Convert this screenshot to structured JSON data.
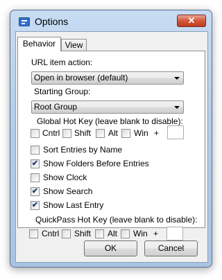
{
  "window": {
    "title": "Options",
    "close_label": "✕"
  },
  "tabs": [
    {
      "label": "Behavior",
      "active": true
    },
    {
      "label": "View",
      "active": false
    }
  ],
  "url_action": {
    "label": "URL item action:",
    "value": "Open in browser (default)"
  },
  "starting_group": {
    "label": "Starting Group:",
    "value": "Root Group"
  },
  "global_hotkey": {
    "label": "Global Hot Key (leave blank to disable):",
    "modifiers": [
      "Cntrl",
      "Shift",
      "Alt",
      "Win"
    ],
    "plus": "+"
  },
  "options": [
    {
      "label": "Sort Entries by Name",
      "checked": false
    },
    {
      "label": "Show Folders Before Entries",
      "checked": true
    },
    {
      "label": "Show Clock",
      "checked": false
    },
    {
      "label": "Show Search",
      "checked": true
    },
    {
      "label": "Show Last Entry",
      "checked": true
    }
  ],
  "quickpass_hotkey": {
    "label": "QuickPass Hot Key (leave blank to disable):",
    "modifiers": [
      "Cntrl",
      "Shift",
      "Alt",
      "Win"
    ],
    "plus": "+"
  },
  "buttons": {
    "ok": "OK",
    "cancel": "Cancel"
  },
  "check_glyph": "✔"
}
